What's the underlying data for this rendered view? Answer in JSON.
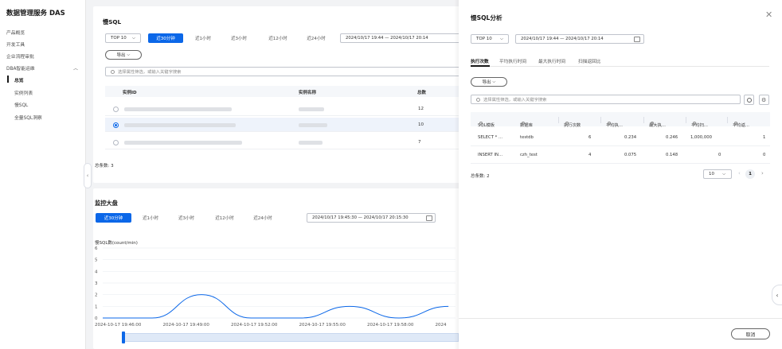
{
  "sidebar": {
    "title": "数据管理服务 DAS",
    "items": [
      {
        "label": "产品概览"
      },
      {
        "label": "开发工具"
      },
      {
        "label": "企业流程审批"
      },
      {
        "label": "DBA智能运维"
      }
    ],
    "sub_items": [
      {
        "label": "总览",
        "active": true
      },
      {
        "label": "实例列表"
      },
      {
        "label": "慢SQL"
      },
      {
        "label": "全量SQL洞察"
      }
    ]
  },
  "slow_sql_panel": {
    "title": "慢SQL",
    "top_select": "TOP 10",
    "time_ranges": [
      "近30分钟",
      "近1小时",
      "近3小时",
      "近12小时",
      "近24小时"
    ],
    "active_range": "近30分钟",
    "date_range": "2024/10/17 19:44 — 2024/10/17 20:14",
    "export_label": "导出",
    "search_placeholder": "选择属性筛选，或输入关键字搜索",
    "columns": [
      "实例ID",
      "实例名称",
      "总数"
    ],
    "rows": [
      {
        "count": "12",
        "selected": false
      },
      {
        "count": "10",
        "selected": true
      },
      {
        "count": "7",
        "selected": false
      }
    ],
    "total": "总条数: 3"
  },
  "monitor_panel": {
    "title": "监控大盘",
    "time_ranges": [
      "近30分钟",
      "近1小时",
      "近3小时",
      "近12小时",
      "近24小时"
    ],
    "active_range": "近30分钟",
    "date_range": "2024/10/17 19:45:30 — 2024/10/17 20:15:30"
  },
  "chart_data": {
    "type": "line",
    "ylabel": "慢SQL数(count/min)",
    "ylim": [
      0,
      6
    ],
    "yticks": [
      "0",
      "1",
      "2",
      "3",
      "4",
      "5",
      "6"
    ],
    "xticks": [
      "2024-10-17 19:46:00",
      "2024-10-17 19:49:00",
      "2024-10-17 19:52:00",
      "2024-10-17 19:55:00",
      "2024-10-17 19:58:00",
      "2024"
    ],
    "series": [
      {
        "values": [
          {
            "x": "19:46:00",
            "y": 0
          },
          {
            "x": "19:48:00",
            "y": 0
          },
          {
            "x": "19:50:00",
            "y": 2
          },
          {
            "x": "19:52:00",
            "y": 0
          },
          {
            "x": "19:54:00",
            "y": 0
          },
          {
            "x": "19:56:00",
            "y": 1
          },
          {
            "x": "19:58:00",
            "y": 0
          },
          {
            "x": "20:00:00",
            "y": 1
          }
        ]
      }
    ],
    "color": "#0b67e8"
  },
  "drawer": {
    "title": "慢SQL分析",
    "top_select": "TOP 10",
    "date_range": "2024/10/17 19:44 — 2024/10/17 20:14",
    "tabs": [
      "执行次数",
      "平均执行时间",
      "最大执行时间",
      "扫描返回比"
    ],
    "active_tab": "执行次数",
    "export_label": "导出",
    "search_placeholder": "选择属性筛选，或输入关键字搜索",
    "columns": [
      "SQL模板",
      "数据库",
      "执行次数",
      "平均执...",
      "最大执...",
      "平均扫...",
      "平均返..."
    ],
    "rows": [
      {
        "template": "SELECT * ...",
        "db": "testdb",
        "exec": "6",
        "avg_time": "0.234",
        "max_time": "0.246",
        "avg_scan": "1,000,000",
        "avg_ret": "1"
      },
      {
        "template": "INSERT IN...",
        "db": "czh_test",
        "exec": "4",
        "avg_time": "0.075",
        "max_time": "0.148",
        "avg_scan": "0",
        "avg_ret": "0"
      }
    ],
    "total": "总条数: 2",
    "page_size": "10",
    "current_page": "1",
    "cancel_label": "取消"
  },
  "colors": {
    "accent": "#0b67e8",
    "background": "#f2f3f5"
  }
}
